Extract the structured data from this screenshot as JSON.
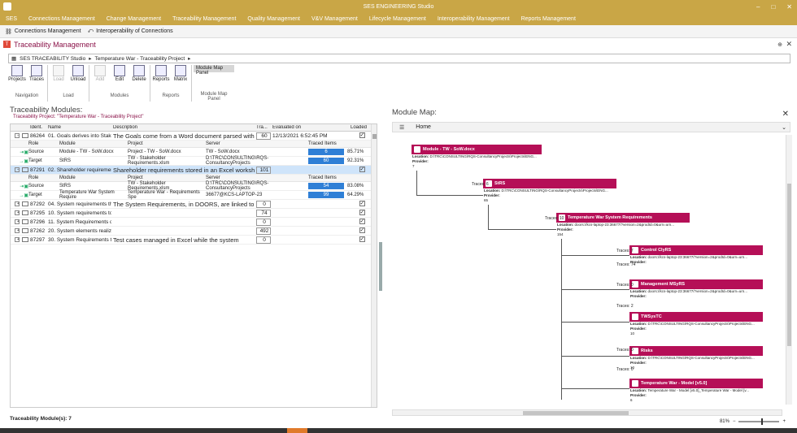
{
  "app": {
    "title": "SES ENGINEERING Studio",
    "win": {
      "min": "–",
      "max": "□",
      "close": "✕"
    }
  },
  "menu": [
    "SES",
    "Connections Management",
    "Change Management",
    "Traceability Management",
    "Quality Management",
    "V&V Management",
    "Lifecycle Management",
    "Interoperability Management",
    "Reports Management"
  ],
  "subtabs": [
    "Connections Management",
    "Interoperability of Connections"
  ],
  "panel": {
    "title": "Traceability Management",
    "badge": "T",
    "pin": "⊕",
    "close": "✕"
  },
  "breadcrumb": [
    "SES TRACEABILITY Studio",
    "Temperature War - Traceability Project"
  ],
  "ribbon": {
    "groups": [
      {
        "label": "Navigation",
        "buttons": [
          {
            "label": "Projects",
            "enabled": true
          },
          {
            "label": "Traces",
            "enabled": true
          }
        ]
      },
      {
        "label": "Load",
        "buttons": [
          {
            "label": "Load",
            "enabled": false
          },
          {
            "label": "Unload",
            "enabled": true
          }
        ]
      },
      {
        "label": "Modules",
        "buttons": [
          {
            "label": "Add",
            "enabled": false
          },
          {
            "label": "Edit",
            "enabled": true
          },
          {
            "label": "Delete",
            "enabled": true
          }
        ]
      },
      {
        "label": "Reports",
        "buttons": [
          {
            "label": "Reports",
            "enabled": true
          },
          {
            "label": "Matrix",
            "enabled": true
          }
        ]
      }
    ],
    "mm_button": "Module Map Panel",
    "mm_label": "Module Map Panel"
  },
  "left": {
    "title": "Traceability Modules:",
    "subtitle": "Traceability Project: \"Temperature War - Traceability Project\"",
    "columns": [
      "Ident.",
      "Name",
      "Description",
      "Tra...",
      "Evaluated on",
      "Loaded"
    ],
    "sub_columns": [
      "Role",
      "Module",
      "Project",
      "Server",
      "Traced Items"
    ],
    "rows": [
      {
        "id": "86264",
        "name": "01. Goals derives into Stake...",
        "desc": "The Goals come from a Word document parsed with",
        "tra": "60",
        "eval": "12/13/2021 6:52:45 PM",
        "loaded": true,
        "expanded": true,
        "selected": false,
        "subs": [
          {
            "role": "Source",
            "module": "Module - TW - SoW.docx",
            "project": "Project - TW - SoW.docx",
            "server": "TW - SoW.docx",
            "count": "6",
            "pct": "85.71%"
          },
          {
            "role": "Target",
            "module": "StRS",
            "project": "TW - Stakeholder Requirements.xlsm",
            "server": "D:\\TRC\\CONSULTING\\RQS-ConsultancyProjects",
            "count": "60",
            "pct": "92.31%"
          }
        ]
      },
      {
        "id": "87291",
        "name": "02. Shareholder requirement...",
        "desc": "Shareholder requirements stored in an Excel worksheet",
        "tra": "101",
        "eval": "",
        "loaded": true,
        "expanded": true,
        "selected": true,
        "subs": [
          {
            "role": "Source",
            "module": "StRS",
            "project": "TW - Stakeholder Requirements.xlsm",
            "server": "D:\\TRC\\CONSULTING\\RQS-ConsultancyProjects",
            "count": "54",
            "pct": "83.08%"
          },
          {
            "role": "Target",
            "module": "Temperature War System Require",
            "project": "Temperature War - Requirements Spe",
            "server": "36677@KCS-LAPTOP-23",
            "count": "99",
            "pct": "64.29%"
          }
        ]
      },
      {
        "id": "87292",
        "name": "04. System requirements thr...",
        "desc": "The System Requirements, in DOORS, are linked to risks",
        "tra": "0",
        "eval": "",
        "loaded": true,
        "expanded": false,
        "selected": false,
        "subs": []
      },
      {
        "id": "87295",
        "name": "10. System requirements to...",
        "desc": "",
        "tra": "74",
        "eval": "",
        "loaded": true,
        "expanded": false,
        "selected": false,
        "subs": []
      },
      {
        "id": "87296",
        "name": "11. System Requirements de...",
        "desc": "",
        "tra": "0",
        "eval": "",
        "loaded": true,
        "expanded": false,
        "selected": false,
        "subs": []
      },
      {
        "id": "87262",
        "name": "20. System elements realize...",
        "desc": "",
        "tra": "492",
        "eval": "",
        "loaded": true,
        "expanded": false,
        "selected": false,
        "subs": []
      },
      {
        "id": "87297",
        "name": "30. System Requirements te...",
        "desc": "Test cases managed in Excel while the system",
        "tra": "0",
        "eval": "",
        "loaded": true,
        "expanded": false,
        "selected": false,
        "subs": []
      }
    ],
    "footer": "Traceability Module(s): 7"
  },
  "right": {
    "title": "Module Map:",
    "close": "✕",
    "breadcrumb": "Home",
    "zoom": "81%",
    "nodes": [
      {
        "title": "Module - TW - SoW.docx",
        "loc": "D:\\TRC\\CONSULTING\\RQS-ConsultancyProjects\\Projects\\ENG...",
        "prov": "7"
      },
      {
        "title": "StRS",
        "loc": "D:\\TRC\\CONSULTING\\RQS-ConsultancyProjects\\Projects\\ENG...",
        "prov": "65"
      },
      {
        "title": "Temperature War System Requirements",
        "loc": "doors://kcs-laptop-23:36677/?version=2&prodId=0&urn=urn...",
        "prov": "154"
      },
      {
        "title": "Control ClyRS",
        "loc": "doors://kcs-laptop-23:36677/?version=2&prodId=0&urn=urn...",
        "prov": ""
      },
      {
        "title": "Management MSyRS",
        "loc": "doors://kcs-laptop-23:36677/?version=2&prodId=0&urn=urn...",
        "prov": ""
      },
      {
        "title": "TWSysTC",
        "loc": "D:\\TRC\\CONSULTING\\RQS-ConsultancyProjects\\Projects\\ENG...",
        "prov": "10"
      },
      {
        "title": "Risks",
        "loc": "D:\\TRC\\CONSULTING\\RQS-ConsultancyProjects\\Projects\\ENG...",
        "prov": "10"
      },
      {
        "title": "Temperature War - Model [v5.0]",
        "loc": "Temperature War - Model [v5.0]_Temperature War - Model [v...",
        "prov": "6"
      }
    ],
    "traces": [
      "Traces: 6",
      "Traces: 10",
      "Traces: 7",
      "Traces: 74",
      "Traces: 0",
      "Traces: 2",
      "Traces: 0",
      "Traces: 0"
    ],
    "labels": {
      "location": "Location:",
      "provider": "Provider:"
    }
  }
}
